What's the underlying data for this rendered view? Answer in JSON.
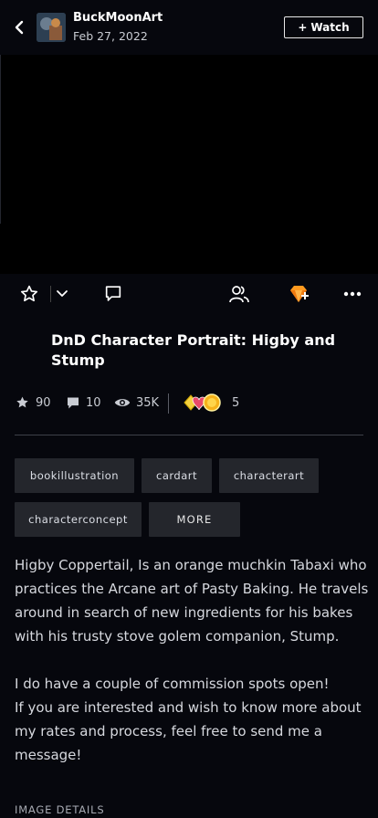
{
  "header": {
    "author": "BuckMoonArt",
    "date": "Feb 27, 2022",
    "watch_label": "Watch",
    "watch_plus": "+"
  },
  "artwork": {
    "alt": "DnD Character Portrait: Higby and Stump"
  },
  "actions": {
    "favourite_icon": "star-outline-icon",
    "collection_icon": "chevron-down-icon",
    "comment_icon": "comment-icon",
    "groups_icon": "users-icon",
    "badge_icon": "gem-badge-icon",
    "more_icon": "ellipsis-icon"
  },
  "title": "DnD Character Portrait: Higby and Stump",
  "stats": {
    "favourites": "90",
    "comments": "10",
    "views": "35K",
    "badges": "5"
  },
  "tags": [
    "bookillustration",
    "cardart",
    "characterart",
    "characterconcept"
  ],
  "more_label": "MORE",
  "description": {
    "para1": "Higby Coppertail, Is an orange muchkin Tabaxi who practices the Arcane art of Pasty Baking. He travels around in search of new ingredients for his bakes with his trusty stove golem companion, Stump.",
    "para2": "I do have a couple of commission spots open!",
    "para3": "If you are interested and wish to know more about my rates and process, feel free to send me a message!"
  },
  "details_label": "IMAGE DETAILS",
  "colors": {
    "background": "#06070d",
    "tag_bg": "#24262c",
    "badge_orange": "#ff9a1f"
  }
}
